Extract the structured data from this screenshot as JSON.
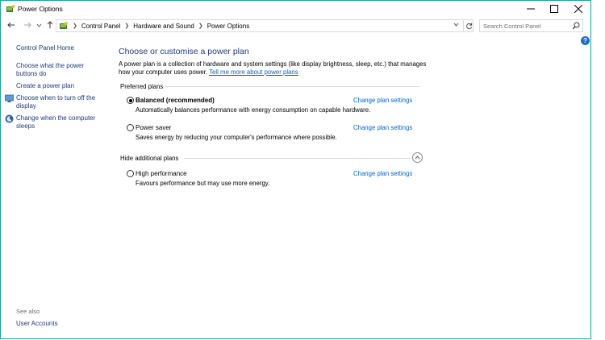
{
  "window": {
    "title": "Power Options",
    "controls": {
      "minimize_icon": "minimize-icon",
      "maximize_icon": "maximize-icon",
      "close_icon": "close-icon"
    }
  },
  "navigation": {
    "breadcrumbs": [
      "Control Panel",
      "Hardware and Sound",
      "Power Options"
    ],
    "search_placeholder": "Search Control Panel"
  },
  "sidebar": {
    "home": "Control Panel Home",
    "links": [
      "Choose what the power buttons do",
      "Create a power plan",
      "Choose when to turn off the display",
      "Change when the computer sleeps"
    ],
    "see_also_label": "See also",
    "see_also_links": [
      "User Accounts"
    ]
  },
  "main": {
    "title": "Choose or customise a power plan",
    "description": "A power plan is a collection of hardware and system settings (like display brightness, sleep, etc.) that manages how your computer uses power.",
    "description_link": "Tell me more about power plans",
    "preferred_label": "Preferred plans",
    "additional_label": "Hide additional plans",
    "plans": [
      {
        "name": "Balanced (recommended)",
        "desc": "Automatically balances performance with energy consumption on capable hardware.",
        "change": "Change plan settings",
        "selected": true
      },
      {
        "name": "Power saver",
        "desc": "Saves energy by reducing your computer's performance where possible.",
        "change": "Change plan settings",
        "selected": false
      },
      {
        "name": "High performance",
        "desc": "Favours performance but may use more energy.",
        "change": "Change plan settings",
        "selected": false
      }
    ]
  },
  "colors": {
    "link": "#0066cc",
    "title": "#1e3a7c",
    "border": "#1aa3a3"
  }
}
